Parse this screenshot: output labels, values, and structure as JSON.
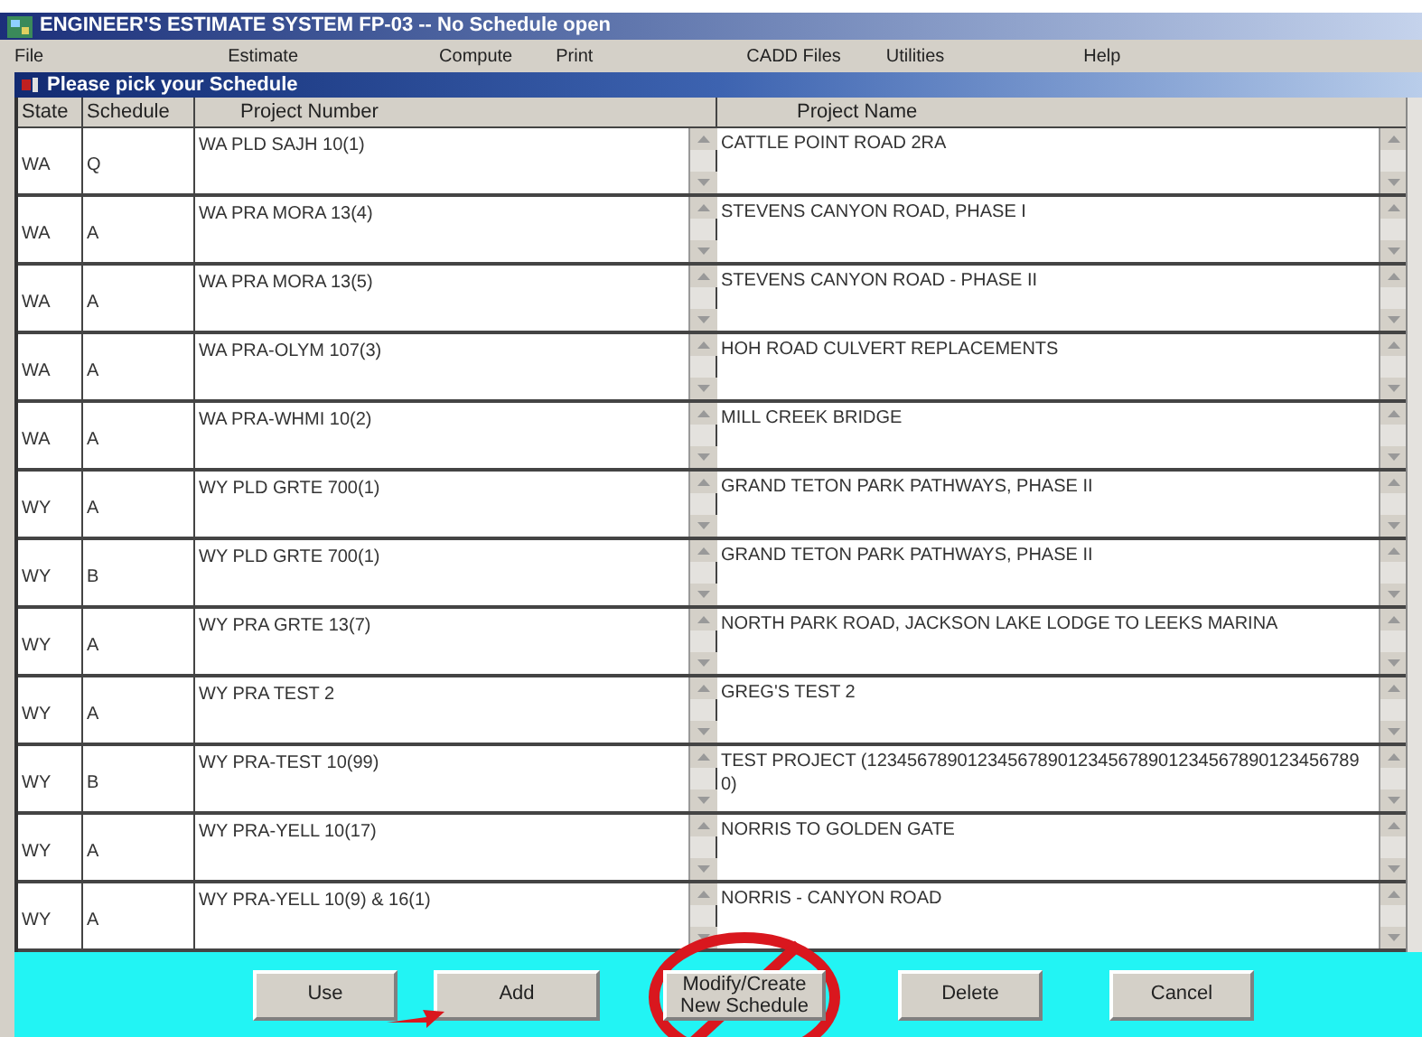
{
  "window": {
    "title": "ENGINEER'S ESTIMATE SYSTEM FP-03 -- No Schedule open"
  },
  "menu": [
    "File",
    "Estimate",
    "Compute",
    "Print",
    "CADD Files",
    "Utilities",
    "Help"
  ],
  "dialog": {
    "title": "Please pick your Schedule"
  },
  "table": {
    "columns": [
      "State",
      "Schedule",
      "Project Number",
      "Project Name"
    ],
    "rows": [
      {
        "state": "WA",
        "schedule": "Q",
        "number": "WA PLD SAJH 10(1)",
        "name": "CATTLE POINT ROAD 2RA"
      },
      {
        "state": "WA",
        "schedule": "A",
        "number": "WA PRA MORA 13(4)",
        "name": "STEVENS CANYON ROAD, PHASE I"
      },
      {
        "state": "WA",
        "schedule": "A",
        "number": "WA PRA MORA 13(5)",
        "name": "STEVENS CANYON ROAD - PHASE II"
      },
      {
        "state": "WA",
        "schedule": "A",
        "number": "WA PRA-OLYM 107(3)",
        "name": "HOH ROAD CULVERT REPLACEMENTS"
      },
      {
        "state": "WA",
        "schedule": "A",
        "number": "WA PRA-WHMI 10(2)",
        "name": "MILL CREEK BRIDGE"
      },
      {
        "state": "WY",
        "schedule": "A",
        "number": "WY PLD GRTE 700(1)",
        "name": "GRAND TETON PARK PATHWAYS, PHASE II"
      },
      {
        "state": "WY",
        "schedule": "B",
        "number": "WY PLD GRTE 700(1)",
        "name": "GRAND TETON PARK PATHWAYS, PHASE II"
      },
      {
        "state": "WY",
        "schedule": "A",
        "number": "WY PRA GRTE 13(7)",
        "name": "NORTH PARK ROAD, JACKSON LAKE LODGE TO LEEKS MARINA"
      },
      {
        "state": "WY",
        "schedule": "A",
        "number": "WY PRA TEST 2",
        "name": "GREG'S TEST 2"
      },
      {
        "state": "WY",
        "schedule": "B",
        "number": "WY PRA-TEST 10(99)",
        "name": "TEST PROJECT (1234567890123456789012345678901234567890123456789 0)"
      },
      {
        "state": "WY",
        "schedule": "A",
        "number": "WY PRA-YELL 10(17)",
        "name": "NORRIS TO GOLDEN GATE"
      },
      {
        "state": "WY",
        "schedule": "A",
        "number": "WY PRA-YELL 10(9) & 16(1)",
        "name": "NORRIS - CANYON ROAD"
      }
    ]
  },
  "buttons": [
    {
      "label": "Use",
      "kind": "plain"
    },
    {
      "label": "Add",
      "kind": "arrowed"
    },
    {
      "label": "Modify/Create New Schedule",
      "kind": "crossed"
    },
    {
      "label": "Delete",
      "kind": "plain"
    },
    {
      "label": "Cancel",
      "kind": "plain"
    }
  ]
}
